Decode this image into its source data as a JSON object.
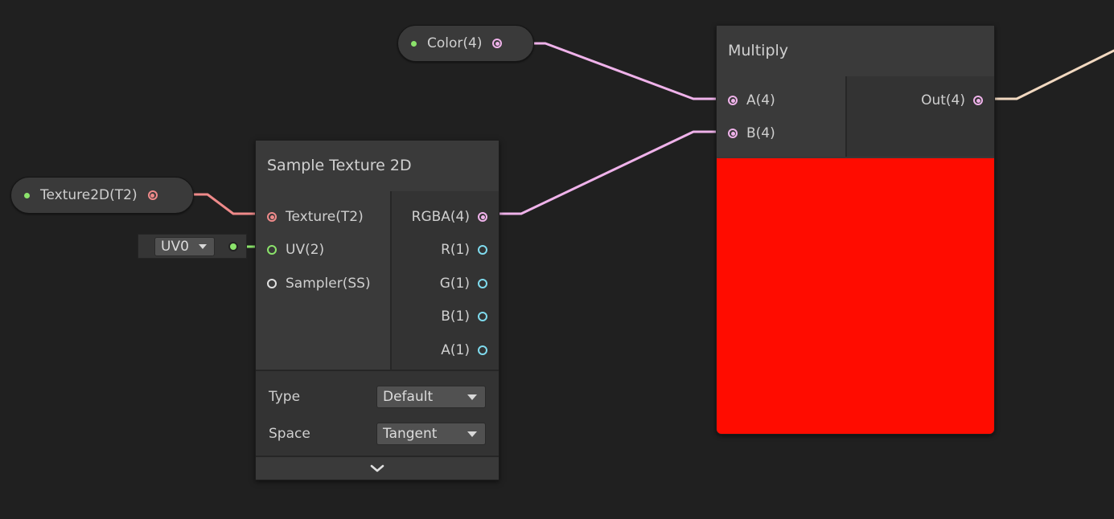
{
  "color_property": {
    "label": "Color(4)"
  },
  "texture_property": {
    "label": "Texture2D(T2)"
  },
  "uv_default": {
    "value": "UV0"
  },
  "sample_texture": {
    "title": "Sample Texture 2D",
    "inputs": [
      "Texture(T2)",
      "UV(2)",
      "Sampler(SS)"
    ],
    "outputs": [
      "RGBA(4)",
      "R(1)",
      "G(1)",
      "B(1)",
      "A(1)"
    ],
    "type_label": "Type",
    "type_value": "Default",
    "space_label": "Space",
    "space_value": "Tangent"
  },
  "multiply": {
    "title": "Multiply",
    "inputs": [
      "A(4)",
      "B(4)"
    ],
    "outputs": [
      "Out(4)"
    ],
    "preview_color": "#ff0c00"
  },
  "colors": {
    "vector4": "#efb2ea",
    "texture": "#ef8a8a",
    "float": "#7fdbee",
    "vector2": "#8be36b"
  }
}
